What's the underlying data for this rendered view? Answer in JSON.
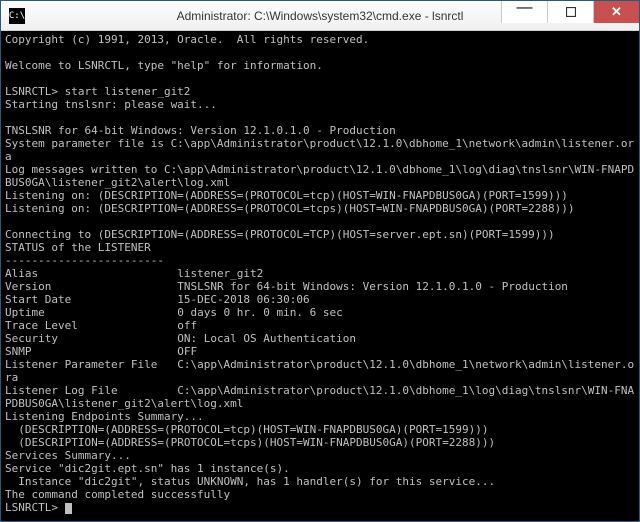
{
  "window": {
    "title": "Administrator: C:\\Windows\\system32\\cmd.exe - lsnrctl",
    "icon_glyph": "C:\\"
  },
  "terminal": {
    "copyright": "Copyright (c) 1991, 2013, Oracle.  All rights reserved.",
    "welcome": "Welcome to LSNRCTL, type \"help\" for information.",
    "prompt1": "LSNRCTL> start listener_git2",
    "starting": "Starting tnslsnr: please wait...",
    "tnslsnr_version": "TNSLSNR for 64-bit Windows: Version 12.1.0.1.0 - Production",
    "sys_param": "System parameter file is C:\\app\\Administrator\\product\\12.1.0\\dbhome_1\\network\\admin\\listener.ora",
    "log_msg": "Log messages written to C:\\app\\Administrator\\product\\12.1.0\\dbhome_1\\log\\diag\\tnslsnr\\WIN-FNAPDBUS0GA\\listener_git2\\alert\\log.xml",
    "listen1": "Listening on: (DESCRIPTION=(ADDRESS=(PROTOCOL=tcp)(HOST=WIN-FNAPDBUS0GA)(PORT=1599)))",
    "listen2": "Listening on: (DESCRIPTION=(ADDRESS=(PROTOCOL=tcps)(HOST=WIN-FNAPDBUS0GA)(PORT=2288)))",
    "connecting": "Connecting to (DESCRIPTION=(ADDRESS=(PROTOCOL=TCP)(HOST=server.ept.sn)(PORT=1599)))",
    "status_hdr": "STATUS of the LISTENER",
    "divider": "------------------------",
    "alias_l": "Alias",
    "alias_v": "listener_git2",
    "version_l": "Version",
    "version_v": "TNSLSNR for 64-bit Windows: Version 12.1.0.1.0 - Production",
    "start_l": "Start Date",
    "start_v": "15-DEC-2018 06:30:06",
    "uptime_l": "Uptime",
    "uptime_v": "0 days 0 hr. 0 min. 6 sec",
    "trace_l": "Trace Level",
    "trace_v": "off",
    "sec_l": "Security",
    "sec_v": "ON: Local OS Authentication",
    "snmp_l": "SNMP",
    "snmp_v": "OFF",
    "lparam_l": "Listener Parameter File",
    "lparam_v": "C:\\app\\Administrator\\product\\12.1.0\\dbhome_1\\network\\admin\\listener.ora",
    "llog_l": "Listener Log File",
    "llog_v": "C:\\app\\Administrator\\product\\12.1.0\\dbhome_1\\log\\diag\\tnslsnr\\WIN-FNAPDBUS0GA\\listener_git2\\alert\\log.xml",
    "endpoints_hdr": "Listening Endpoints Summary...",
    "ep1": "  (DESCRIPTION=(ADDRESS=(PROTOCOL=tcp)(HOST=WIN-FNAPDBUS0GA)(PORT=1599)))",
    "ep2": "  (DESCRIPTION=(ADDRESS=(PROTOCOL=tcps)(HOST=WIN-FNAPDBUS0GA)(PORT=2288)))",
    "services_hdr": "Services Summary...",
    "service1": "Service \"dic2git.ept.sn\" has 1 instance(s).",
    "instance1": "  Instance \"dic2git\", status UNKNOWN, has 1 handler(s) for this service...",
    "completed": "The command completed successfully",
    "prompt2": "LSNRCTL> "
  }
}
